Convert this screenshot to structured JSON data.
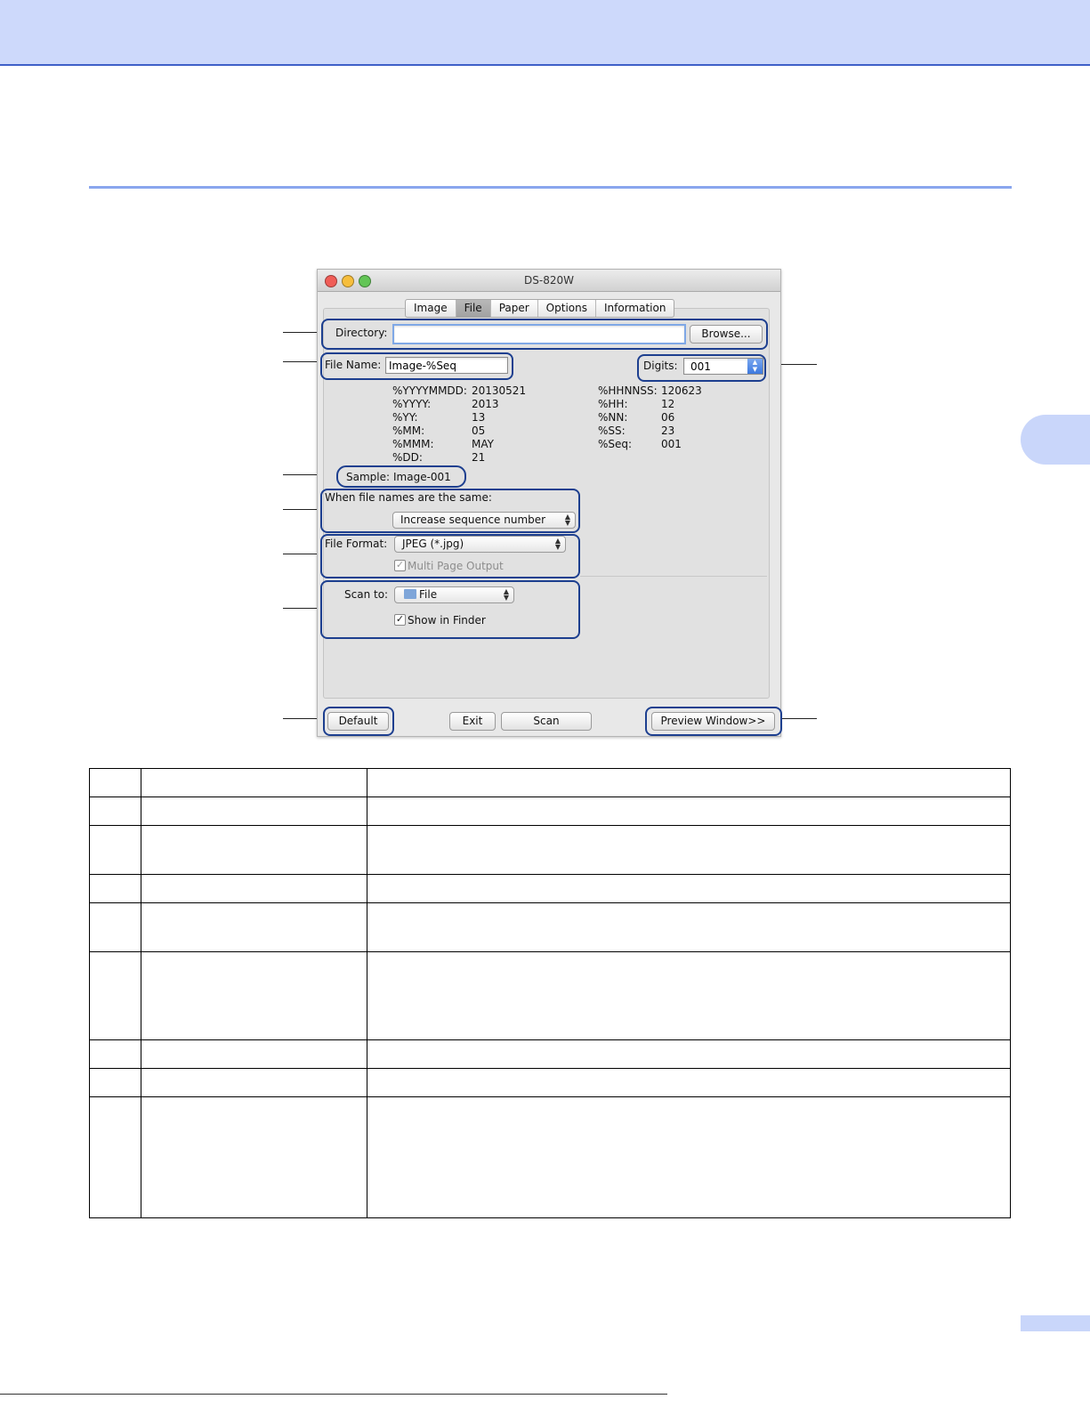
{
  "window": {
    "title": "DS-820W",
    "tabs": [
      "Image",
      "File",
      "Paper",
      "Options",
      "Information"
    ],
    "selected_tab": "File"
  },
  "directory": {
    "label": "Directory:",
    "value": "",
    "browse_label": "Browse..."
  },
  "file_name": {
    "label": "File Name:",
    "value": "Image-%Seq"
  },
  "digits": {
    "label": "Digits:",
    "value": "001"
  },
  "tokens_left": [
    {
      "key": "%YYYYMMDD:",
      "value": "20130521"
    },
    {
      "key": "%YYYY:",
      "value": "2013"
    },
    {
      "key": "%YY:",
      "value": "13"
    },
    {
      "key": "%MM:",
      "value": "05"
    },
    {
      "key": "%MMM:",
      "value": "MAY"
    },
    {
      "key": "%DD:",
      "value": "21"
    }
  ],
  "tokens_right": [
    {
      "key": "%HHNNSS:",
      "value": "120623"
    },
    {
      "key": "%HH:",
      "value": "12"
    },
    {
      "key": "%NN:",
      "value": "06"
    },
    {
      "key": "%SS:",
      "value": "23"
    },
    {
      "key": "%Seq:",
      "value": "001"
    }
  ],
  "sample": {
    "label": "Sample:",
    "value": "Image-001"
  },
  "same_names": {
    "label": "When file names are the same:",
    "value": "Increase sequence number"
  },
  "file_format": {
    "label": "File Format:",
    "value": "JPEG (*.jpg)",
    "multi_page_label": "Multi Page Output",
    "multi_page_checked": true
  },
  "scan_to": {
    "label": "Scan to:",
    "value": "File",
    "show_in_finder_label": "Show in Finder",
    "show_in_finder_checked": true
  },
  "buttons": {
    "default": "Default",
    "exit": "Exit",
    "scan": "Scan",
    "preview": "Preview Window>>"
  },
  "colors": {
    "callout": "#1d3f8f",
    "page_accent": "#cdd9fb",
    "rule": "#8aa6ee"
  }
}
